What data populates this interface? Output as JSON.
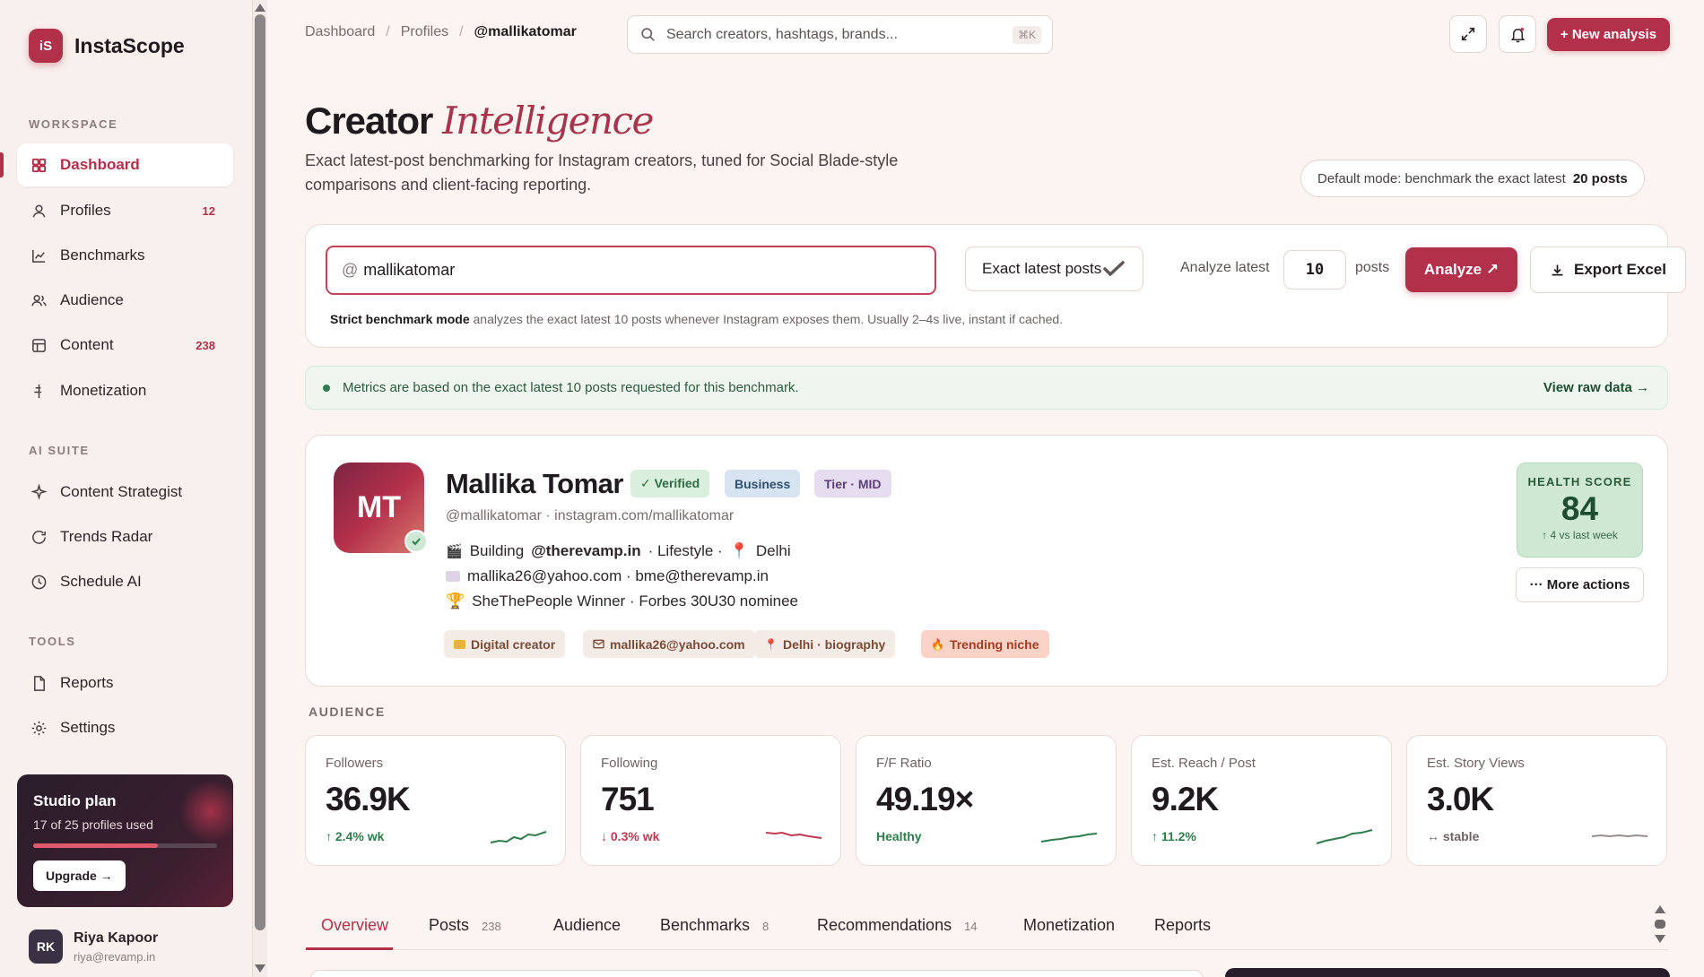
{
  "app": {
    "name": "InstaScope",
    "logo_initials": "iS"
  },
  "sidebar": {
    "workspace_label": "WORKSPACE",
    "ai_label": "AI SUITE",
    "tools_label": "TOOLS",
    "items": [
      {
        "label": "Dashboard",
        "icon": "grid-icon"
      },
      {
        "label": "Profiles",
        "count": "12",
        "icon": "user-icon"
      },
      {
        "label": "Benchmarks",
        "icon": "chart-icon"
      },
      {
        "label": "Audience",
        "icon": "users-icon"
      },
      {
        "label": "Content",
        "count": "238",
        "icon": "layout-icon"
      },
      {
        "label": "Monetization",
        "icon": "dollar-icon"
      }
    ],
    "ai_items": [
      {
        "label": "Content Strategist",
        "icon": "sparkle-icon"
      },
      {
        "label": "Trends Radar",
        "icon": "radar-icon"
      },
      {
        "label": "Schedule AI",
        "icon": "clock-icon"
      }
    ],
    "tool_items": [
      {
        "label": "Reports",
        "icon": "file-icon"
      },
      {
        "label": "Settings",
        "icon": "gear-icon"
      }
    ],
    "plan": {
      "title": "Studio plan",
      "usage": "17 of 25 profiles used",
      "usage_fraction": 0.68,
      "upgrade_label": "Upgrade →"
    },
    "user": {
      "initials": "RK",
      "name": "Riya Kapoor",
      "email": "riya@revamp.in"
    }
  },
  "header": {
    "breadcrumbs": [
      "Dashboard",
      "Profiles",
      "@mallikatomar"
    ],
    "separator": "/",
    "search_placeholder": "Search creators, hashtags, brands...",
    "search_shortcut": "⌘K",
    "new_button": "+ New analysis"
  },
  "hero": {
    "title_main": "Creator",
    "title_accent": "Intelligence",
    "subtitle": "Exact latest-post benchmarking for Instagram creators, tuned for Social Blade-style comparisons and client-facing reporting.",
    "mode_label": "Default mode: benchmark the exact latest",
    "mode_value": "20 posts"
  },
  "analyzer": {
    "at": "@",
    "handle": "mallikatomar",
    "mode_select": "Exact latest posts",
    "analyze_latest_label": "Analyze latest",
    "post_count": "10",
    "posts_label": "posts",
    "analyze_button": "Analyze ↗",
    "export_button": "Export Excel",
    "strict_label": "Strict benchmark mode",
    "strict_text": "analyzes the exact latest 10 posts whenever Instagram exposes them. Usually 2–4s live, instant if cached."
  },
  "banner": {
    "text": "Metrics are based on the exact latest 10 posts requested for this benchmark.",
    "link": "View raw data →"
  },
  "profile": {
    "initials": "MT",
    "name": "Mallika Tomar",
    "badges": [
      "✓ Verified",
      "Business",
      "Tier · MID"
    ],
    "handle_line": "@mallikatomar · instagram.com/mallikatomar",
    "bio1_prefix": "Building",
    "bio1_brand": "@therevamp.in",
    "bio1_suffix": "· Lifestyle ·",
    "bio1_city": "Delhi",
    "bio2": "mallika26@yahoo.com · bme@therevamp.in",
    "bio3": "SheThePeople Winner · Forbes 30U30 nominee",
    "chips": [
      "Digital creator",
      "mallika26@yahoo.com",
      "Delhi · biography",
      "Trending niche"
    ],
    "health": {
      "label": "HEALTH SCORE",
      "value": "84",
      "change": "↑ 4 vs last week"
    },
    "more_actions": "··· More actions"
  },
  "audience": {
    "title": "AUDIENCE",
    "metrics": [
      {
        "label": "Followers",
        "value": "36.9K",
        "change": "↑ 2.4% wk",
        "trend": "up"
      },
      {
        "label": "Following",
        "value": "751",
        "change": "↓ 0.3% wk",
        "trend": "down"
      },
      {
        "label": "F/F Ratio",
        "value": "49.19×",
        "change": "Healthy",
        "trend": "up"
      },
      {
        "label": "Est. Reach / Post",
        "value": "9.2K",
        "change": "↑ 11.2%",
        "trend": "up"
      },
      {
        "label": "Est. Story Views",
        "value": "3.0K",
        "change": "↔ stable",
        "trend": "flat"
      }
    ]
  },
  "tabs": [
    {
      "label": "Overview",
      "count": ""
    },
    {
      "label": "Posts",
      "count": "238"
    },
    {
      "label": "Audience",
      "count": ""
    },
    {
      "label": "Benchmarks",
      "count": "8"
    },
    {
      "label": "Recommendations",
      "count": "14"
    },
    {
      "label": "Monetization",
      "count": ""
    },
    {
      "label": "Reports",
      "count": ""
    }
  ],
  "colors": {
    "accent": "#b3304a",
    "success": "#2f7d4c",
    "danger": "#c0394f"
  }
}
